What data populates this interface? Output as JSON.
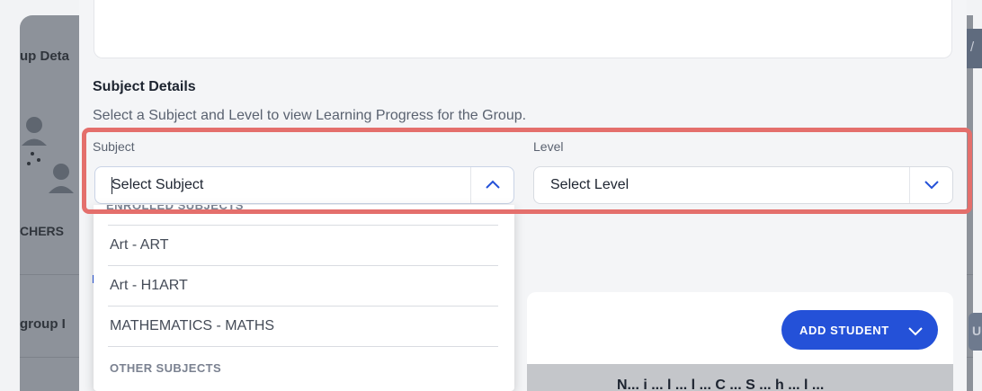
{
  "background": {
    "group_details_tab": "up Deta",
    "teachers_tab": "CHERS",
    "subgroup_label": "group I",
    "right_edge_text": "/",
    "right_button_text": "U"
  },
  "modal": {
    "subject_details_title": "Subject Details",
    "subject_details_description": "Select a Subject and Level to view Learning Progress for the Group.",
    "subject": {
      "label": "Subject",
      "value": "Select Subject"
    },
    "level": {
      "label": "Level",
      "value": "Select Level"
    },
    "dropdown": {
      "enrolled_group_label": "ENROLLED SUBJECTS",
      "options": [
        "Art - ART",
        "Art - H1ART",
        "MATHEMATICS - MATHS"
      ],
      "other_group_label": "OTHER SUBJECTS"
    },
    "add_student_label": "ADD STUDENT",
    "cut_off_text": "N... i ... l ... l ... C ... S ... h ... l ..."
  },
  "colors": {
    "accent": "#2451d8",
    "highlight": "#e46f6c",
    "overlay": "#8d929a"
  },
  "icons": {
    "subject_chevron": "chevron-up-icon",
    "level_chevron": "chevron-down-icon",
    "add_student_chevron": "chevron-down-icon",
    "avatar": "group-avatar-icon"
  }
}
